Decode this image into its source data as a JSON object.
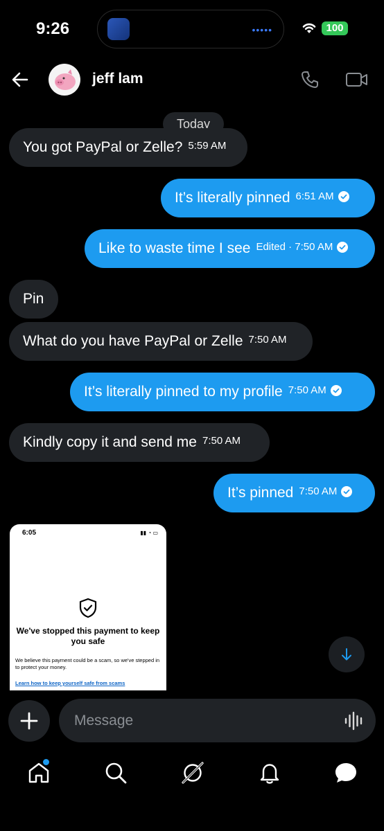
{
  "status_bar": {
    "time": "9:26",
    "battery": "100"
  },
  "header": {
    "contact_name": "jeff lam"
  },
  "date_divider": "Today",
  "messages": [
    {
      "text": "You got PayPal or Zelle?",
      "time": "5:59 AM"
    },
    {
      "text": "It’s literally pinned",
      "time": "6:51 AM"
    },
    {
      "text": "Like to waste time I see",
      "time": "Edited · 7:50 AM"
    },
    {
      "text": "Pin",
      "time": ""
    },
    {
      "text": "What do you have PayPal or Zelle",
      "time": "7:50 AM"
    },
    {
      "text": "It’s literally pinned to my profile",
      "time": "7:50 AM"
    },
    {
      "text": "Kindly copy it and send me",
      "time": "7:50 AM"
    },
    {
      "text": "It’s pinned",
      "time": "7:50 AM"
    }
  ],
  "image_message": {
    "time": "6:05",
    "title": "We've stopped this payment to keep you safe",
    "body": "We believe this payment could be a scam, so we've stepped in to protect your money.",
    "link": "Learn how to keep yourself safe from scams"
  },
  "composer": {
    "placeholder": "Message"
  },
  "colors": {
    "outgoing": "#1d9bf0",
    "incoming": "#202327",
    "background": "#000000"
  },
  "icons": [
    "back-arrow-icon",
    "phone-icon",
    "video-icon",
    "plus-icon",
    "voice-waveform-icon",
    "home-icon",
    "search-icon",
    "grok-icon",
    "bell-icon",
    "messages-icon"
  ]
}
